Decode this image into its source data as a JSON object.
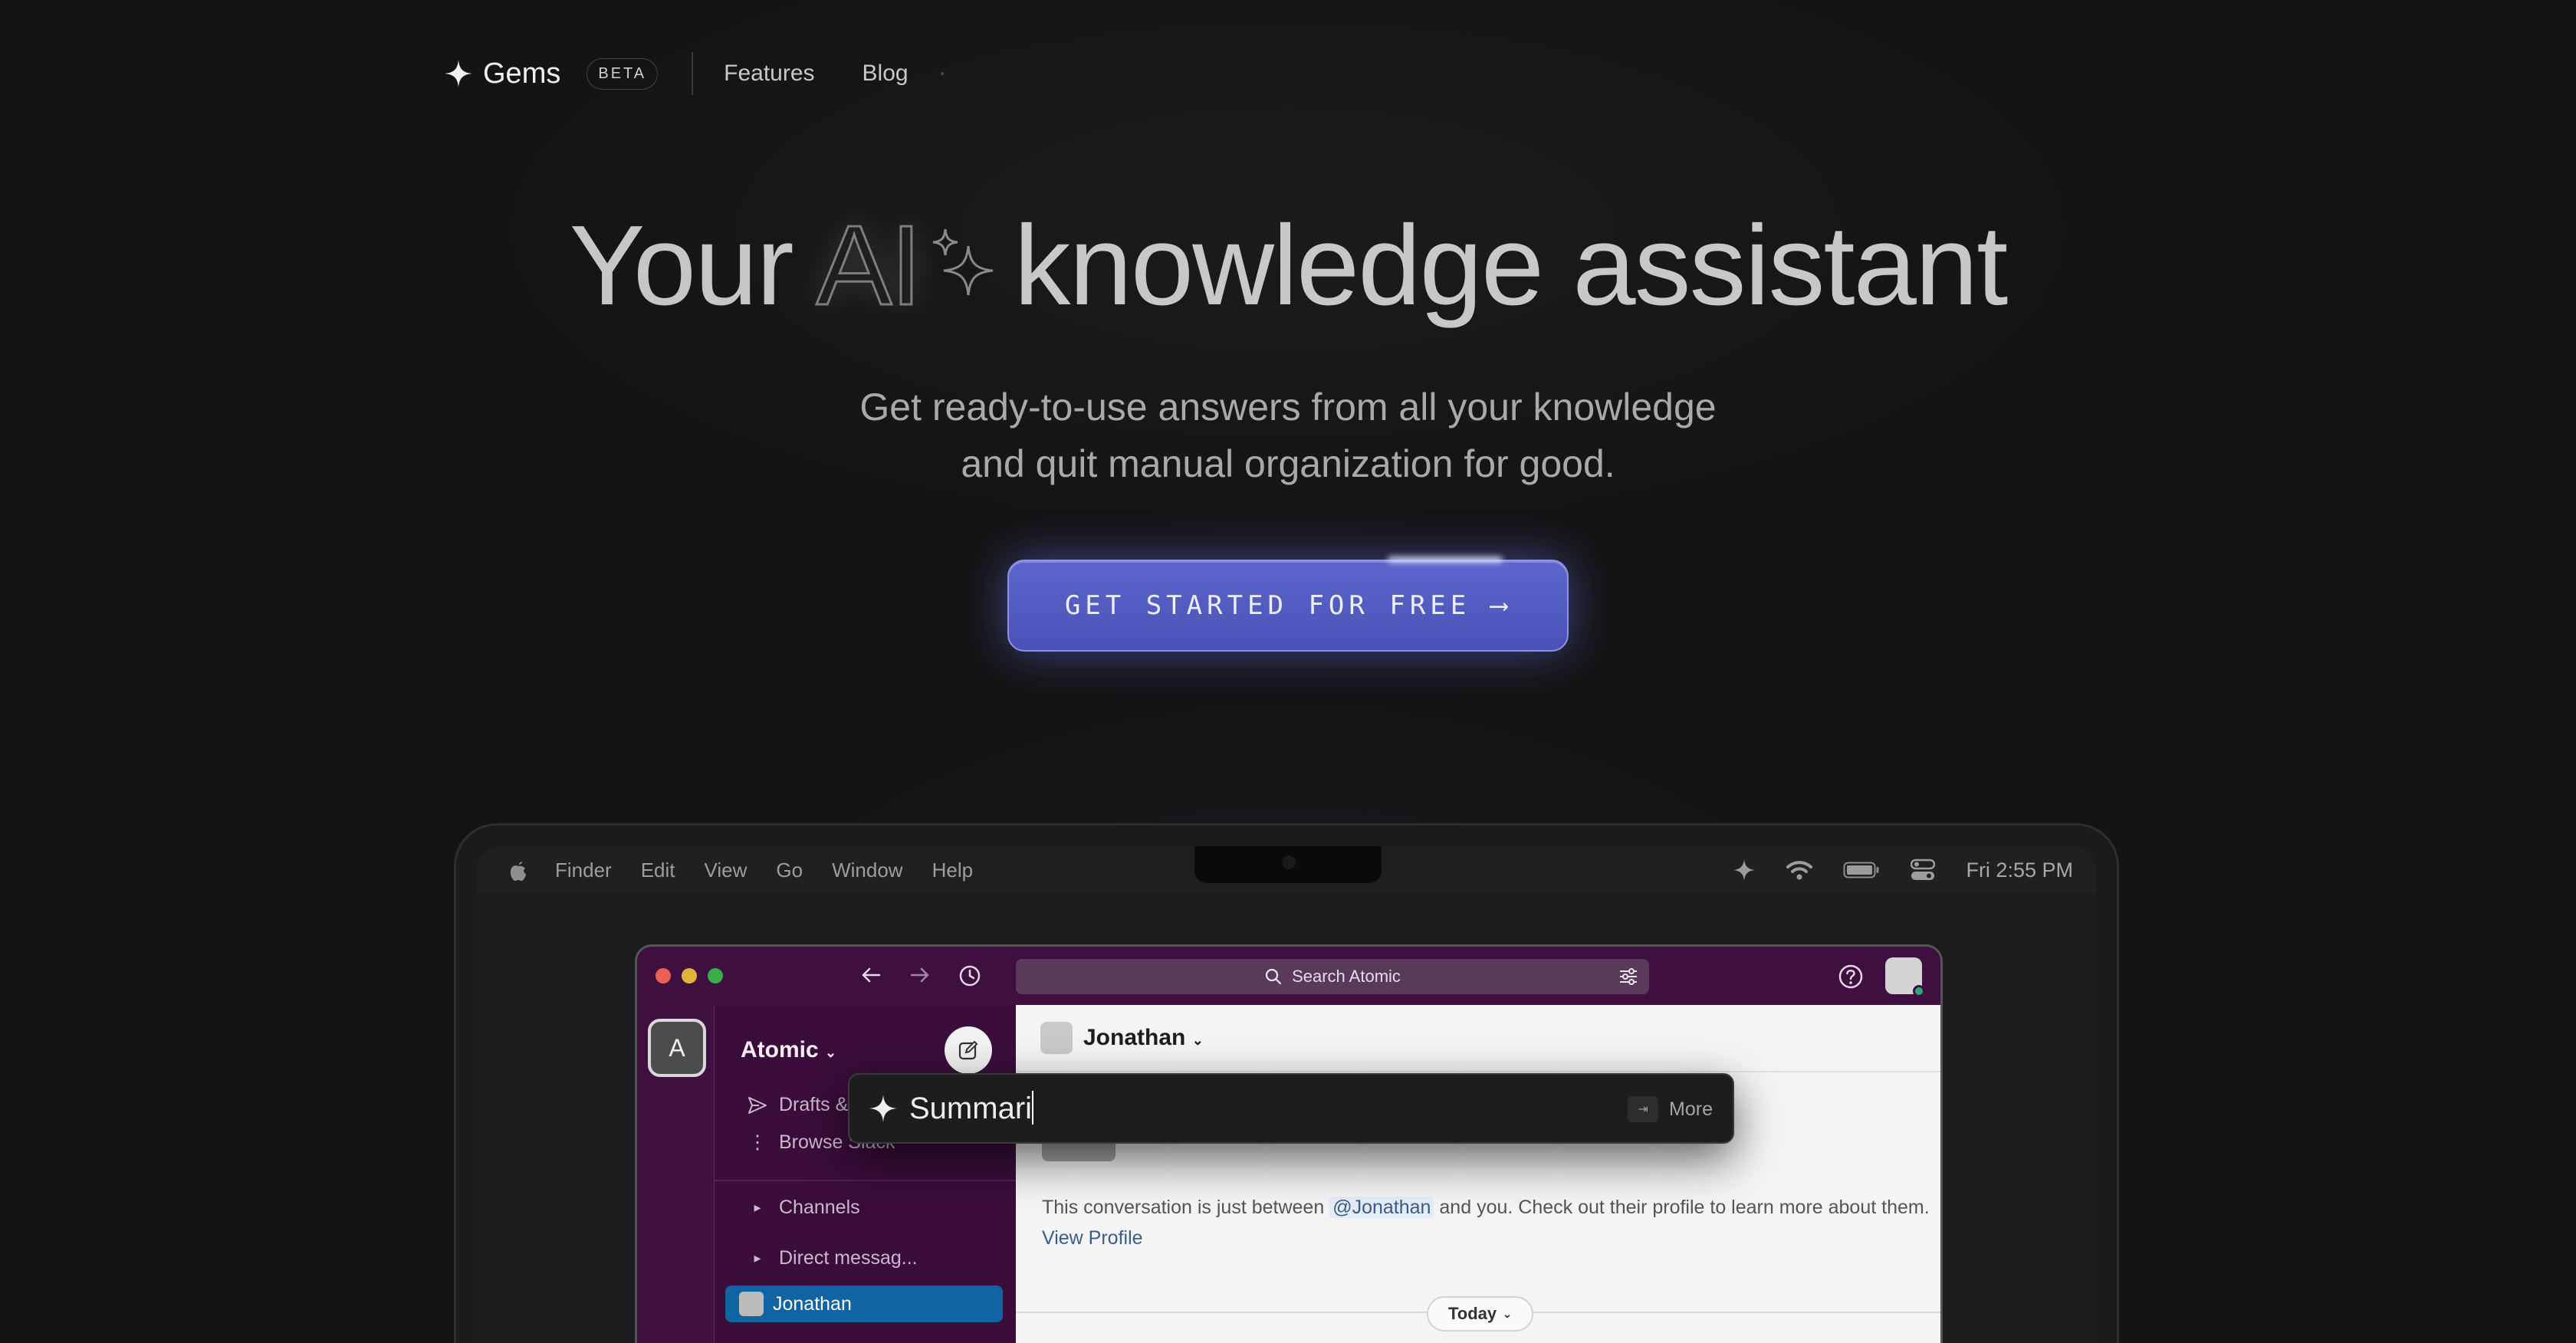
{
  "nav": {
    "brand": "Gems",
    "badge": "BETA",
    "links": [
      "Features",
      "Blog"
    ]
  },
  "hero": {
    "title_your": "Your",
    "title_ai": "AI",
    "title_rest": "knowledge assistant",
    "subtitle_line1": "Get ready-to-use answers from all your knowledge",
    "subtitle_line2": "and quit manual organization for good.",
    "cta_label": "GET STARTED FOR FREE ⟶"
  },
  "mac_menubar": {
    "items": [
      "Finder",
      "Edit",
      "View",
      "Go",
      "Window",
      "Help"
    ],
    "clock": "Fri 2:55 PM"
  },
  "slack": {
    "search_placeholder": "Search Atomic",
    "workspace_letter": "A",
    "workspace_name": "Atomic",
    "sidebar": {
      "drafts": "Drafts &",
      "browse": "Browse Slack",
      "channels": "Channels",
      "direct": "Direct messag...",
      "active_dm": "Jonathan"
    },
    "channel": {
      "name": "Jonathan",
      "intro_before": "This conversation is just between",
      "mention": "@Jonathan",
      "intro_after": "and you. Check out their profile to learn more about them.",
      "view_profile": "View Profile",
      "day_divider": "Today"
    }
  },
  "gems_overlay": {
    "query": "Summari",
    "kbd_hint": "⇥",
    "more_label": "More"
  },
  "colors": {
    "background": "#141414",
    "cta": "#5059c0",
    "slack_aubergine": "#3f0e40",
    "slack_active": "#1164a3"
  }
}
